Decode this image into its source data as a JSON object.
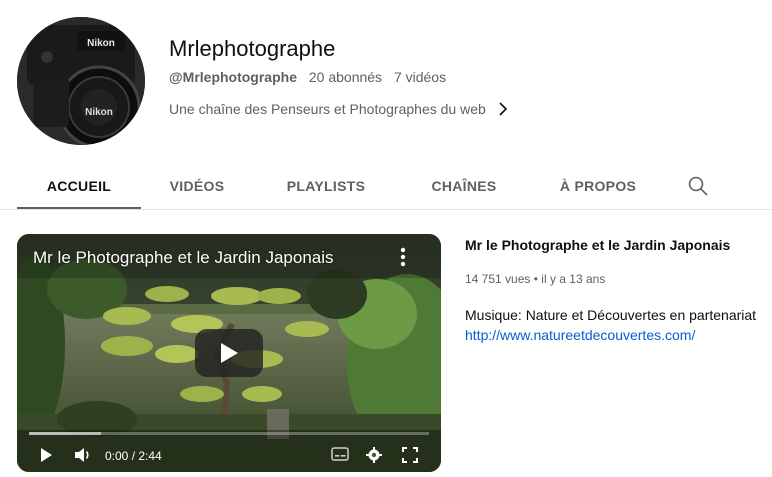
{
  "channel": {
    "name": "Mrlephotographe",
    "handle": "@Mrlephotographe",
    "subscribers": "20 abonnés",
    "videos_count": "7 vidéos",
    "description": "Une chaîne des Penseurs et Photographes du web",
    "avatar_icon": "camera-avatar",
    "avatar_brand_text": [
      "Nikon",
      "Nikon"
    ]
  },
  "tabs": [
    {
      "label": "ACCUEIL",
      "active": true
    },
    {
      "label": "VIDÉOS",
      "active": false
    },
    {
      "label": "PLAYLISTS",
      "active": false
    },
    {
      "label": "CHAÎNES",
      "active": false
    },
    {
      "label": "À PROPOS",
      "active": false
    }
  ],
  "search_icon": "search-icon",
  "featured_video": {
    "title": "Mr le Photographe et le Jardin Japonais",
    "time_current": "0:00",
    "time_total": "2:44",
    "time_display": "0:00 / 2:44",
    "progress_buffered": 0.18,
    "icons": [
      "play-icon",
      "volume-icon",
      "subtitles-icon",
      "settings-icon",
      "fullscreen-icon",
      "more-vert-icon"
    ]
  },
  "video_info": {
    "title": "Mr le Photographe et le Jardin Japonais",
    "views": "14 751 vues",
    "separator": "•",
    "age": "il y a 13 ans",
    "description": "Musique: Nature et Découvertes en partenariat",
    "link": "http://www.natureetdecouvertes.com/"
  },
  "colors": {
    "text_primary": "#0f0f0f",
    "text_secondary": "#606060",
    "link": "#065fd4",
    "tab_underline": "#606060",
    "divider": "#e5e5e5"
  }
}
